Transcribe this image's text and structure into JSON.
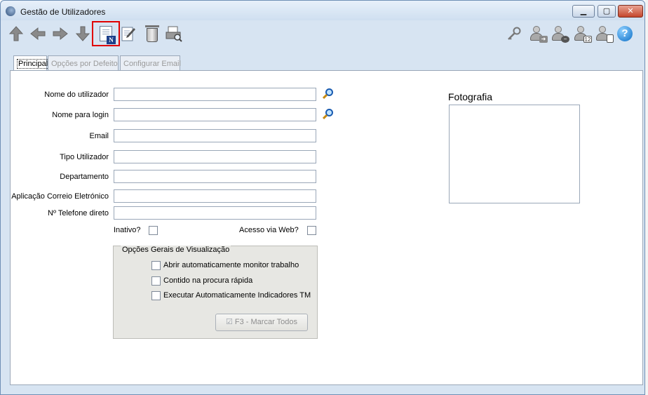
{
  "window": {
    "title": "Gestão de Utilizadores",
    "min_label": "▁",
    "max_label": "▢",
    "close_label": "✕"
  },
  "toolbar": {
    "left_icons": [
      "arrow-up-icon",
      "arrow-left-icon",
      "arrow-right-icon",
      "arrow-down-icon",
      "new-document-icon",
      "edit-document-icon",
      "delete-trash-icon",
      "print-preview-icon"
    ],
    "right_icons": [
      "key-icon",
      "user-transfer-icon",
      "user-remove-icon",
      "user-calendar-icon",
      "user-report-icon",
      "help-icon"
    ],
    "new_badge": "N",
    "calendar_badge": "12",
    "help_label": "?"
  },
  "tabs": [
    {
      "label": "Principal",
      "active": true
    },
    {
      "label": "Opções por Defeito",
      "active": false
    },
    {
      "label": "Configurar Email",
      "active": false
    }
  ],
  "form": {
    "fields": [
      {
        "label": "Nome do utilizador",
        "value": ""
      },
      {
        "label": "Nome para login",
        "value": ""
      },
      {
        "label": "Email",
        "value": ""
      },
      {
        "label": "Tipo Utilizador",
        "value": ""
      },
      {
        "label": "Departamento",
        "value": ""
      },
      {
        "label": "Aplicação Correio Eletrónico",
        "value": ""
      },
      {
        "label": "Nº Telefone direto",
        "value": ""
      }
    ],
    "inativo_label": "Inativo?",
    "web_label": "Acesso via Web?"
  },
  "group": {
    "title": "Opções Gerais de Visualização",
    "options": [
      "Abrir automaticamente monitor trabalho",
      "Contido na procura rápida",
      "Executar Automaticamente Indicadores TM"
    ],
    "button_label": "F3 - Marcar Todos"
  },
  "photo": {
    "label": "Fotografia"
  },
  "colors": {
    "highlight": "#e00000",
    "window_bg": "#d7e4f2"
  }
}
